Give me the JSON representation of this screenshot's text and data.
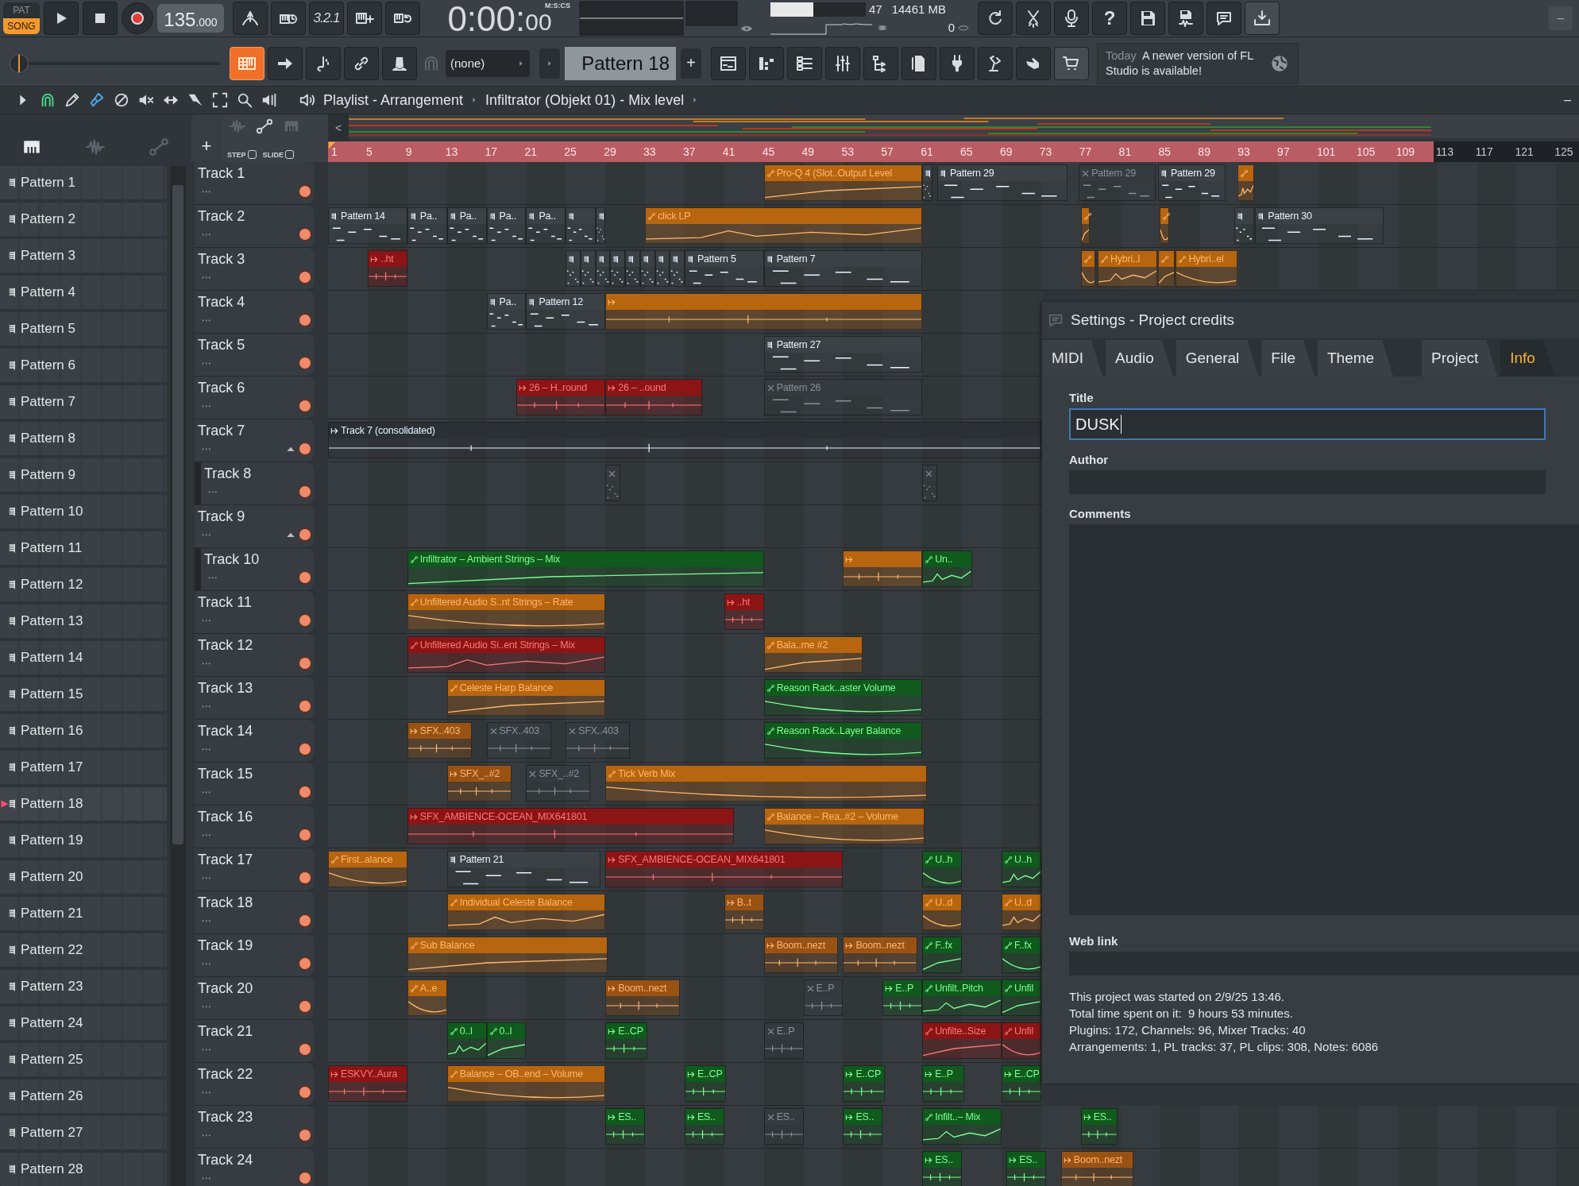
{
  "transport": {
    "modes": [
      {
        "label": "PAT",
        "selected": false
      },
      {
        "label": "SONG",
        "selected": true
      }
    ],
    "tempo": "135",
    "tempo_decimals": ".000",
    "countdown": "3.2.1",
    "time": "0:00:",
    "time_cs": "00",
    "time_format": "M:S:CS"
  },
  "monitor": {
    "cpu": {
      "level": 0.45,
      "reading": "47"
    },
    "memory": "14461 MB",
    "polyphony": "0"
  },
  "help_label": "?",
  "window_controls": {
    "minimize": "–"
  },
  "master": {
    "level": 0.0
  },
  "pattern_picker": {
    "snap": "(none)",
    "pattern": "Pattern 18",
    "add": "+"
  },
  "news": {
    "when": "Today",
    "message": "A newer version of FL Studio is available!"
  },
  "playlist_bar": {
    "crumbs": [
      "Playlist - Arrangement",
      "Infiltrator (Objekt 01) - Mix level"
    ],
    "minimize": "–"
  },
  "header": {
    "add": "+",
    "step": {
      "label": "STEP",
      "checked": false
    },
    "slide": {
      "label": "SLIDE",
      "checked": false
    },
    "scroll_left": "<"
  },
  "ruler": [
    "1",
    "5",
    "9",
    "13",
    "17",
    "21",
    "25",
    "29",
    "33",
    "37",
    "41",
    "45",
    "49",
    "53",
    "57",
    "61",
    "65",
    "69",
    "73",
    "77",
    "81",
    "85",
    "89",
    "93",
    "97",
    "101",
    "105",
    "109",
    "113",
    "117",
    "121",
    "125"
  ],
  "patterns": [
    {
      "label": "Pattern 1",
      "selected": false
    },
    {
      "label": "Pattern 2",
      "selected": false
    },
    {
      "label": "Pattern 3",
      "selected": false
    },
    {
      "label": "Pattern 4",
      "selected": false
    },
    {
      "label": "Pattern 5",
      "selected": false
    },
    {
      "label": "Pattern 6",
      "selected": false
    },
    {
      "label": "Pattern 7",
      "selected": false
    },
    {
      "label": "Pattern 8",
      "selected": false
    },
    {
      "label": "Pattern 9",
      "selected": false
    },
    {
      "label": "Pattern 10",
      "selected": false
    },
    {
      "label": "Pattern 11",
      "selected": false
    },
    {
      "label": "Pattern 12",
      "selected": false
    },
    {
      "label": "Pattern 13",
      "selected": false
    },
    {
      "label": "Pattern 14",
      "selected": false
    },
    {
      "label": "Pattern 15",
      "selected": false
    },
    {
      "label": "Pattern 16",
      "selected": false
    },
    {
      "label": "Pattern 17",
      "selected": false
    },
    {
      "label": "Pattern 18",
      "selected": true
    },
    {
      "label": "Pattern 19",
      "selected": false
    },
    {
      "label": "Pattern 20",
      "selected": false
    },
    {
      "label": "Pattern 21",
      "selected": false
    },
    {
      "label": "Pattern 22",
      "selected": false
    },
    {
      "label": "Pattern 23",
      "selected": false
    },
    {
      "label": "Pattern 24",
      "selected": false
    },
    {
      "label": "Pattern 25",
      "selected": false
    },
    {
      "label": "Pattern 26",
      "selected": false
    },
    {
      "label": "Pattern 27",
      "selected": false
    },
    {
      "label": "Pattern 28",
      "selected": false
    }
  ],
  "tracks": [
    {
      "name": "Track 1",
      "clips": [
        {
          "label": "Pro-Q 4 (Slot..Output Level",
          "kind": "automation",
          "color": "#b8650f",
          "muted": false
        },
        {
          "kind": "pattern",
          "color": "#3c4146",
          "muted": false
        },
        {
          "label": "Pattern 29",
          "kind": "pattern",
          "color": "#3c4146",
          "muted": false
        },
        {
          "label": "Pattern 29",
          "kind": "pattern",
          "color": "#353a3f",
          "muted": true
        },
        {
          "label": "Pattern 29",
          "kind": "pattern",
          "color": "#3c4146",
          "muted": false
        },
        {
          "kind": "automation",
          "color": "#b8650f",
          "muted": false
        }
      ]
    },
    {
      "name": "Track 2",
      "clips": [
        {
          "label": "Pattern 14",
          "kind": "pattern",
          "color": "#3c4146",
          "muted": false
        },
        {
          "label": "Pa..",
          "kind": "pattern",
          "color": "#3c4146",
          "muted": false
        },
        {
          "label": "Pa..",
          "kind": "pattern",
          "color": "#3c4146",
          "muted": false
        },
        {
          "label": "Pa..",
          "kind": "pattern",
          "color": "#3c4146",
          "muted": false
        },
        {
          "label": "Pa..",
          "kind": "pattern",
          "color": "#3c4146",
          "muted": false
        },
        {
          "kind": "pattern",
          "color": "#3c4146",
          "muted": false
        },
        {
          "kind": "pattern",
          "color": "#3c4146",
          "muted": false
        },
        {
          "label": "click LP",
          "kind": "automation",
          "color": "#b8650f",
          "muted": false
        },
        {
          "kind": "automation",
          "color": "#b8650f",
          "muted": false
        },
        {
          "kind": "automation",
          "color": "#b8650f",
          "muted": false
        },
        {
          "kind": "pattern",
          "color": "#3c4146",
          "muted": false
        },
        {
          "label": "Pattern 30",
          "kind": "pattern",
          "color": "#3c4146",
          "muted": false
        }
      ]
    },
    {
      "name": "Track 3",
      "clips": [
        {
          "label": "..ht",
          "kind": "audio",
          "color": "#8c1414",
          "muted": false
        },
        {
          "kind": "pattern",
          "color": "#3c4146",
          "muted": false
        },
        {
          "kind": "pattern",
          "color": "#3c4146",
          "muted": false
        },
        {
          "kind": "pattern",
          "color": "#3c4146",
          "muted": false
        },
        {
          "kind": "pattern",
          "color": "#3c4146",
          "muted": false
        },
        {
          "kind": "pattern",
          "color": "#3c4146",
          "muted": false
        },
        {
          "kind": "pattern",
          "color": "#3c4146",
          "muted": false
        },
        {
          "kind": "pattern",
          "color": "#3c4146",
          "muted": false
        },
        {
          "kind": "pattern",
          "color": "#3c4146",
          "muted": false
        },
        {
          "label": "Pattern 5",
          "kind": "pattern",
          "color": "#3c4146",
          "muted": false
        },
        {
          "label": "Pattern 7",
          "kind": "pattern",
          "color": "#3c4146",
          "muted": false
        },
        {
          "kind": "automation",
          "color": "#b8650f",
          "muted": false
        },
        {
          "label": "Hybri..l",
          "kind": "automation",
          "color": "#b8650f",
          "muted": false
        },
        {
          "kind": "automation",
          "color": "#b8650f",
          "muted": false
        },
        {
          "label": "Hybri..el",
          "kind": "automation",
          "color": "#b8650f",
          "muted": false
        }
      ]
    },
    {
      "name": "Track 4",
      "clips": [
        {
          "label": "Pa..",
          "kind": "pattern",
          "color": "#3c4146",
          "muted": false
        },
        {
          "label": "Pattern 12",
          "kind": "pattern",
          "color": "#3c4146",
          "muted": false
        },
        {
          "kind": "audio",
          "color": "#b8650f",
          "muted": false
        }
      ]
    },
    {
      "name": "Track 5",
      "clips": [
        {
          "label": "Pattern 27",
          "kind": "pattern",
          "color": "#3c4146",
          "muted": false
        }
      ]
    },
    {
      "name": "Track 6",
      "clips": [
        {
          "label": "26 – H..round",
          "kind": "audio",
          "color": "#8c1414",
          "muted": false
        },
        {
          "label": "26 – ..ound",
          "kind": "audio",
          "color": "#8c1414",
          "muted": false
        },
        {
          "label": "Pattern 26",
          "kind": "pattern",
          "color": "#353a3f",
          "muted": true
        }
      ]
    },
    {
      "name": "Track 7",
      "expanded": true,
      "clips": [
        {
          "label": "Track 7 (consolidated)",
          "kind": "audio",
          "color": "#2b3034",
          "muted": false
        }
      ],
      "children": [
        {
          "name": "Track 8",
          "clips": [
            {
              "kind": "pattern",
              "color": "#353a3f",
              "muted": true
            },
            {
              "kind": "pattern",
              "color": "#353a3f",
              "muted": true
            }
          ]
        }
      ]
    },
    {
      "name": "Track 9",
      "expanded": true,
      "children": [
        {
          "name": "Track 10",
          "clips": [
            {
              "label": "Infiltrator – Ambient Strings – Mix",
              "kind": "automation",
              "color": "#0f5a1c",
              "muted": false
            },
            {
              "kind": "audio",
              "color": "#b8650f",
              "muted": false
            },
            {
              "label": "Un..",
              "kind": "automation",
              "color": "#0f5a1c",
              "muted": false
            }
          ]
        }
      ]
    },
    {
      "name": "Track 11",
      "clips": [
        {
          "label": "Unfiltered Audio S..nt Strings – Rate",
          "kind": "automation",
          "color": "#b8650f",
          "muted": false
        },
        {
          "label": "..ht",
          "kind": "audio",
          "color": "#8c1414",
          "muted": false
        }
      ]
    },
    {
      "name": "Track 12",
      "clips": [
        {
          "label": "Unfiltered Audio Si..ent Strings – Mix",
          "kind": "automation",
          "color": "#8c1414",
          "muted": false
        },
        {
          "label": "Bala..me #2",
          "kind": "automation",
          "color": "#b8650f",
          "muted": false
        }
      ]
    },
    {
      "name": "Track 13",
      "clips": [
        {
          "label": "Celeste Harp Balance",
          "kind": "automation",
          "color": "#b8650f",
          "muted": false
        },
        {
          "label": "Reason Rack..aster Volume",
          "kind": "automation",
          "color": "#0f5a1c",
          "muted": false
        }
      ]
    },
    {
      "name": "Track 14",
      "clips": [
        {
          "label": "SFX..403",
          "kind": "audio",
          "color": "#9a5212",
          "muted": false
        },
        {
          "label": "SFX..403",
          "kind": "audio",
          "color": "#353a3f",
          "muted": true
        },
        {
          "label": "SFX..403",
          "kind": "audio",
          "color": "#353a3f",
          "muted": true
        },
        {
          "label": "Reason Rack..Layer Balance",
          "kind": "automation",
          "color": "#0f5a1c",
          "muted": false
        }
      ]
    },
    {
      "name": "Track 15",
      "clips": [
        {
          "label": "SFX_..#2",
          "kind": "audio",
          "color": "#9a5212",
          "muted": false
        },
        {
          "label": "SFX_..#2",
          "kind": "audio",
          "color": "#353a3f",
          "muted": true
        },
        {
          "label": "Tick Verb Mix",
          "kind": "automation",
          "color": "#b8650f",
          "muted": false
        }
      ]
    },
    {
      "name": "Track 16",
      "clips": [
        {
          "label": "SFX_AMBIENCE-OCEAN_MIX641801",
          "kind": "audio",
          "color": "#8c1414",
          "muted": false
        },
        {
          "label": "Balance – Rea..#2 – Volume",
          "kind": "automation",
          "color": "#b8650f",
          "muted": false
        }
      ]
    },
    {
      "name": "Track 17",
      "clips": [
        {
          "label": "First..alance",
          "kind": "automation",
          "color": "#b8650f",
          "muted": false
        },
        {
          "label": "Pattern 21",
          "kind": "pattern",
          "color": "#3c4146",
          "muted": false
        },
        {
          "label": "SFX_AMBIENCE-OCEAN_MIX641801",
          "kind": "audio",
          "color": "#8c1414",
          "muted": false
        },
        {
          "label": "U..h",
          "kind": "automation",
          "color": "#0f5a1c",
          "muted": false
        },
        {
          "label": "U..h",
          "kind": "automation",
          "color": "#0f5a1c",
          "muted": false
        }
      ]
    },
    {
      "name": "Track 18",
      "clips": [
        {
          "label": "Individual Celeste Balance",
          "kind": "automation",
          "color": "#b8650f",
          "muted": false
        },
        {
          "label": "B..t",
          "kind": "audio",
          "color": "#9a5212",
          "muted": false
        },
        {
          "label": "U..d",
          "kind": "automation",
          "color": "#b8650f",
          "muted": false
        },
        {
          "label": "U..d",
          "kind": "automation",
          "color": "#b8650f",
          "muted": false
        }
      ]
    },
    {
      "name": "Track 19",
      "clips": [
        {
          "label": "Sub Balance",
          "kind": "automation",
          "color": "#b8650f",
          "muted": false
        },
        {
          "label": "Boom..nezt",
          "kind": "audio",
          "color": "#9a5212",
          "muted": false
        },
        {
          "label": "Boom..nezt",
          "kind": "audio",
          "color": "#9a5212",
          "muted": false
        },
        {
          "label": "F..fx",
          "kind": "automation",
          "color": "#0f5a1c",
          "muted": false
        },
        {
          "label": "F..fx",
          "kind": "automation",
          "color": "#0f5a1c",
          "muted": false
        }
      ]
    },
    {
      "name": "Track 20",
      "clips": [
        {
          "label": "A..e",
          "kind": "automation",
          "color": "#b8650f",
          "muted": false
        },
        {
          "label": "Boom..nezt",
          "kind": "audio",
          "color": "#9a5212",
          "muted": false
        },
        {
          "label": "E..P",
          "kind": "audio",
          "color": "#353a3f",
          "muted": true
        },
        {
          "label": "E..P",
          "kind": "audio",
          "color": "#0f5a1c",
          "muted": false
        },
        {
          "label": "Unfilt..Pitch",
          "kind": "automation",
          "color": "#0f5a1c",
          "muted": false
        },
        {
          "label": "Unfil",
          "kind": "automation",
          "color": "#0f5a1c",
          "muted": false
        }
      ]
    },
    {
      "name": "Track 21",
      "clips": [
        {
          "label": "0..l",
          "kind": "automation",
          "color": "#0f5a1c",
          "muted": false
        },
        {
          "label": "0..l",
          "kind": "automation",
          "color": "#0f5a1c",
          "muted": false
        },
        {
          "label": "E..CP",
          "kind": "audio",
          "color": "#0f5a1c",
          "muted": false
        },
        {
          "label": "E..P",
          "kind": "audio",
          "color": "#353a3f",
          "muted": true
        },
        {
          "label": "Unfilte..Size",
          "kind": "automation",
          "color": "#8c1414",
          "muted": false
        },
        {
          "label": "Unfil",
          "kind": "automation",
          "color": "#8c1414",
          "muted": false
        }
      ]
    },
    {
      "name": "Track 22",
      "clips": [
        {
          "label": "ESKVY..Aura",
          "kind": "audio",
          "color": "#8c1414",
          "muted": false
        },
        {
          "label": "Balance – OB..end – Volume",
          "kind": "automation",
          "color": "#b8650f",
          "muted": false
        },
        {
          "label": "E..CP",
          "kind": "audio",
          "color": "#0f5a1c",
          "muted": false
        },
        {
          "label": "E..CP",
          "kind": "audio",
          "color": "#0f5a1c",
          "muted": false
        },
        {
          "label": "E..P",
          "kind": "audio",
          "color": "#0f5a1c",
          "muted": false
        },
        {
          "label": "E..CP",
          "kind": "audio",
          "color": "#0f5a1c",
          "muted": false
        }
      ]
    },
    {
      "name": "Track 23",
      "clips": [
        {
          "label": "ES..",
          "kind": "audio",
          "color": "#0f5a1c",
          "muted": false
        },
        {
          "label": "ES..",
          "kind": "audio",
          "color": "#0f5a1c",
          "muted": false
        },
        {
          "label": "ES..",
          "kind": "audio",
          "color": "#353a3f",
          "muted": true
        },
        {
          "label": "ES..",
          "kind": "audio",
          "color": "#0f5a1c",
          "muted": false
        },
        {
          "label": "Infilt..– Mix",
          "kind": "automation",
          "color": "#0f5a1c",
          "muted": false
        },
        {
          "label": "ES..",
          "kind": "audio",
          "color": "#0f5a1c",
          "muted": false
        }
      ]
    },
    {
      "name": "Track 24",
      "clips": [
        {
          "label": "ES..",
          "kind": "audio",
          "color": "#0f5a1c",
          "muted": false
        },
        {
          "label": "ES..",
          "kind": "audio",
          "color": "#0f5a1c",
          "muted": false
        },
        {
          "label": "Boom..nezt",
          "kind": "audio",
          "color": "#9a5212",
          "muted": false
        }
      ]
    }
  ],
  "settings": {
    "title": "Settings - Project credits",
    "tab_groups": [
      [
        {
          "label": "MIDI",
          "selected": false
        },
        {
          "label": "Audio",
          "selected": false
        },
        {
          "label": "General",
          "selected": false
        },
        {
          "label": "File",
          "selected": false
        },
        {
          "label": "Theme",
          "selected": false
        }
      ],
      [
        {
          "label": "Project",
          "selected": false
        },
        {
          "label": "Info",
          "selected": true
        }
      ]
    ],
    "fields": [
      {
        "kind": "line",
        "label": "Title",
        "value": "DUSK",
        "focused": true
      },
      {
        "kind": "line",
        "label": "Author",
        "focused": false
      },
      {
        "kind": "area",
        "label": "Comments",
        "focused": false
      },
      {
        "kind": "line",
        "label": "Web link",
        "focused": false
      }
    ],
    "info": [
      "This project was started on 2/9/25 13:46.",
      "Total time spent on it:  9 hours 53 minutes.",
      "Plugins: 172, Channels: 96, Mixer Tracks: 40",
      "Arrangements: 1, PL tracks: 37, PL clips: 308, Notes: 6086"
    ]
  }
}
